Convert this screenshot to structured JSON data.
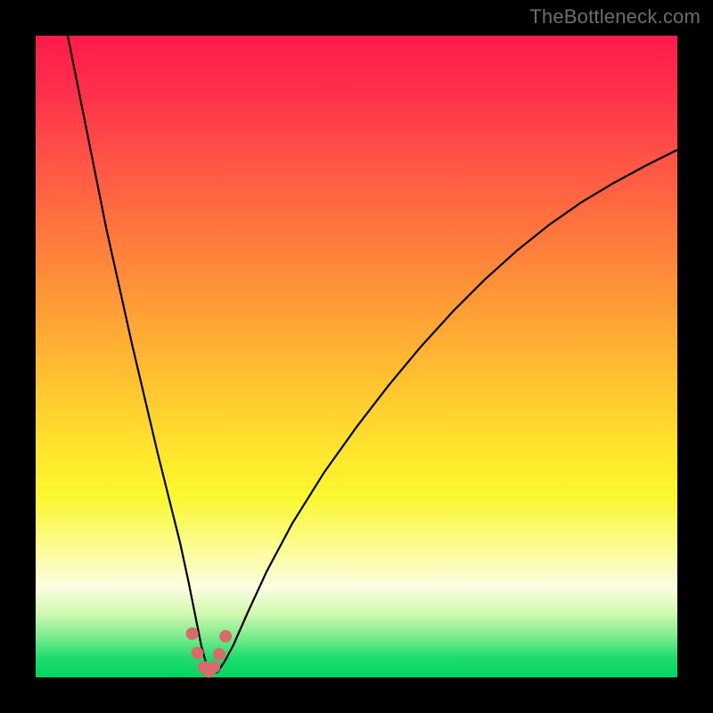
{
  "watermark": "TheBottleneck.com",
  "chart_data": {
    "type": "line",
    "title": "",
    "xlabel": "",
    "ylabel": "",
    "xlim": [
      0,
      100
    ],
    "ylim": [
      0,
      100
    ],
    "background_gradient": {
      "top_color": "#ff1a4a",
      "bottom_color": "#00d463",
      "note": "red→orange→yellow→green top-to-bottom"
    },
    "series": [
      {
        "name": "bottleneck-curve",
        "color": "#000000",
        "x": [
          5.0,
          7.0,
          9.0,
          11.0,
          13.0,
          15.0,
          17.0,
          19.0,
          21.0,
          22.5,
          23.8,
          25.0,
          25.8,
          26.5,
          27.4,
          28.3,
          29.4,
          30.8,
          33.0,
          36.0,
          40.0,
          45.0,
          50.0,
          55.0,
          60.0,
          65.0,
          70.0,
          75.0,
          80.0,
          85.0,
          90.0,
          95.0,
          100.0
        ],
        "y": [
          100.0,
          90.0,
          80.0,
          70.0,
          61.0,
          52.0,
          43.5,
          35.0,
          27.0,
          21.0,
          15.0,
          9.0,
          5.0,
          2.4,
          0.8,
          0.8,
          2.4,
          5.0,
          10.0,
          16.5,
          24.0,
          32.0,
          39.0,
          45.5,
          51.5,
          57.0,
          62.0,
          66.5,
          70.5,
          74.0,
          77.0,
          79.7,
          82.2
        ]
      }
    ],
    "markers": {
      "name": "trough-markers",
      "color": "#d86a6a",
      "points": [
        {
          "x": 24.4,
          "y": 6.8
        },
        {
          "x": 25.2,
          "y": 3.8
        },
        {
          "x": 26.2,
          "y": 1.6
        },
        {
          "x": 27.0,
          "y": 0.9
        },
        {
          "x": 27.8,
          "y": 1.6
        },
        {
          "x": 28.6,
          "y": 3.6
        },
        {
          "x": 29.6,
          "y": 6.4
        }
      ]
    },
    "annotations": []
  }
}
